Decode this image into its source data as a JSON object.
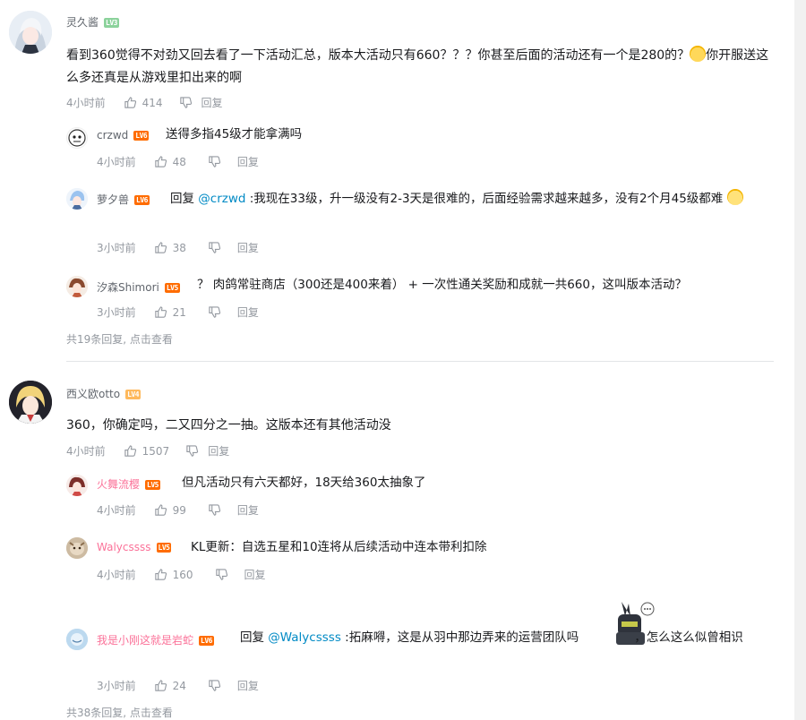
{
  "colors": {
    "level_badge": "#f59a51",
    "level_badge_high": "#ff6c00",
    "link": "#008ac5",
    "vip_name": "#fb7299"
  },
  "comments": [
    {
      "user": "灵久酱",
      "level": "LV3",
      "text": "看到360觉得不对劲又回去看了一下活动汇总，版本大活动只有660？？？你甚至后面的活动还有一个是280的？",
      "text_tail": "你开服送这么多还真是从游戏里扣出来的啊",
      "time": "4小时前",
      "likes": "414",
      "reply_label": "回复",
      "replies": [
        {
          "user": "crzwd",
          "level": "LV6",
          "text": "送得多指45级才能拿满吗",
          "time": "4小时前",
          "likes": "48",
          "reply_label": "回复"
        },
        {
          "user": "萝夕兽",
          "level": "LV6",
          "prefix": "回复 ",
          "mention": "@crzwd",
          "text": " :我现在33级，升一级没有2-3天是很难的，后面经验需求越来越多，没有2个月45级都难",
          "time": "3小时前",
          "likes": "38",
          "reply_label": "回复"
        },
        {
          "user": "汐森Shimori",
          "level": "LV5",
          "text": "？ 肉鸽常驻商店（300还是400来着） + 一次性通关奖励和成就一共660，这叫版本活动？",
          "time": "3小时前",
          "likes": "21",
          "reply_label": "回复"
        }
      ],
      "more": "共19条回复, 点击查看"
    },
    {
      "user": "西义欧otto",
      "level": "LV4",
      "text": "360，你确定吗，二又四分之一抽。这版本还有其他活动没",
      "time": "4小时前",
      "likes": "1507",
      "reply_label": "回复",
      "replies": [
        {
          "user": "火舞流樱",
          "level": "LV5",
          "text": "但凡活动只有六天都好，18天给360太抽象了",
          "time": "4小时前",
          "likes": "99",
          "reply_label": "回复"
        },
        {
          "user": "Walycssss",
          "level": "LV5",
          "text": "KL更新：自选五星和10连将从后续活动中连本带利扣除",
          "time": "4小时前",
          "likes": "160",
          "reply_label": "回复"
        },
        {
          "user": "我是小刚这就是岩蛇",
          "level": "LV6",
          "prefix": "回复 ",
          "mention": "@Walycssss",
          "text": " :拓麻嘚，这是从羽中那边弄来的运营团队吗",
          "text_tail": "，怎么这么似曾相识",
          "time": "3小时前",
          "likes": "24",
          "reply_label": "回复"
        }
      ],
      "more": "共38条回复, 点击查看"
    }
  ]
}
